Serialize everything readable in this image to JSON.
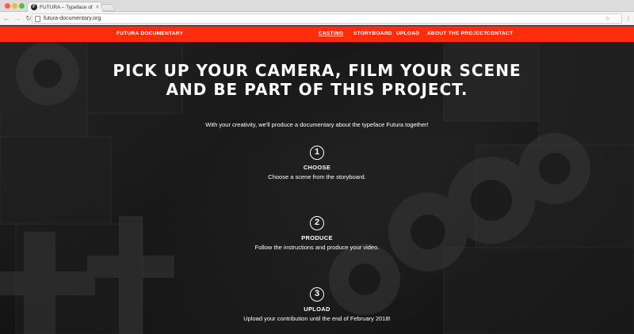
{
  "browser": {
    "tab_title": "FUTURA – Typeface of our Ti",
    "tab_favicon": "F",
    "url": "futura-documentary.org"
  },
  "site": {
    "brand": "FUTURA DOCUMENTARY",
    "nav": [
      {
        "label": "CASTING",
        "active": true
      },
      {
        "label": "STORYBOARD",
        "active": false
      },
      {
        "label": "UPLOAD",
        "active": false
      },
      {
        "label": "ABOUT THE PROJECT",
        "active": false
      },
      {
        "label": "CONTACT",
        "active": false
      }
    ],
    "accent_color": "#ff2d0e"
  },
  "hero": {
    "headline_line1": "PICK UP YOUR CAMERA, FILM YOUR SCENE",
    "headline_line2": "AND BE PART OF THIS PROJECT.",
    "intro": "With your creativity, we'll produce a documentary about the typeface Futura together!",
    "steps": [
      {
        "number": "1",
        "title": "CHOOSE",
        "desc": "Choose a scene from the storyboard."
      },
      {
        "number": "2",
        "title": "PRODUCE",
        "desc": "Follow the instructions and produce your video."
      },
      {
        "number": "3",
        "title": "UPLOAD",
        "desc": "Upload your contribution until the end of February 2018!"
      }
    ]
  }
}
